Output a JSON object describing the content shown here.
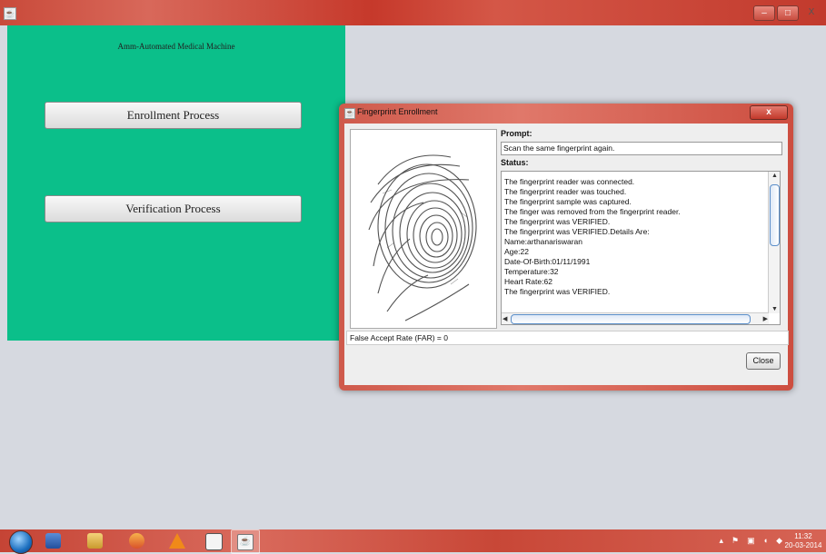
{
  "window": {
    "minimize_label": "–",
    "maximize_label": "□",
    "close_label": "X"
  },
  "app": {
    "title": "Amm-Automated Medical Machine",
    "enrollment_button": "Enrollment Process",
    "verification_button": "Verification Process"
  },
  "dialog": {
    "title": "Fingerprint Enrollment",
    "close_x": "x",
    "prompt_label": "Prompt:",
    "prompt_value": "Scan the same fingerprint again.",
    "status_label": "Status:",
    "status_lines": [
      "The fingerprint reader was connected.",
      "The fingerprint reader was touched.",
      "The fingerprint sample was captured.",
      "The finger was removed from the fingerprint reader.",
      "The fingerprint was VERIFIED.",
      "The fingerprint was VERIFIED.Details Are:",
      "Name:arthanariswaran",
      "Age:22",
      "Date-Of-Birth:01/11/1991",
      "Temperature:32",
      "Heart Rate:62",
      "The fingerprint was VERIFIED."
    ],
    "far_text": "False Accept Rate (FAR) = 0",
    "close_button": "Close"
  },
  "taskbar": {
    "clock_time": "11:32",
    "clock_date": "20-03-2014",
    "icons": [
      "windows-start-icon",
      "media-player-icon",
      "file-explorer-icon",
      "paint-icon",
      "vlc-icon",
      "document-icon",
      "java-icon"
    ],
    "tray_icons": [
      "up-arrow-icon",
      "flag-icon",
      "network-icon",
      "volume-icon",
      "shield-icon"
    ]
  },
  "colors": {
    "panel_green": "#0bbf8a",
    "titlebar_red": "#c94a3a",
    "background": "#d6d9e0"
  }
}
